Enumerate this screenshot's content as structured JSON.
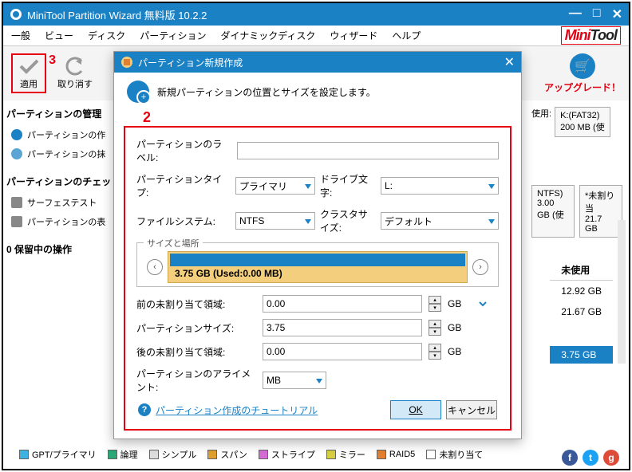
{
  "titlebar": {
    "title": "MiniTool Partition Wizard 無料版 10.2.2"
  },
  "menu": [
    "一般",
    "ビュー",
    "ディスク",
    "パーティション",
    "ダイナミックディスク",
    "ウィザード",
    "ヘルプ"
  ],
  "toolbar": {
    "apply": "適用",
    "undo": "取り消す",
    "upgrade": "アップグレード！"
  },
  "sidebar": {
    "sec1": {
      "head": "パーティションの管理",
      "items": [
        "パーティションの作",
        "パーティションの抹"
      ]
    },
    "sec2": {
      "head": "パーティションのチェッ",
      "items": [
        "サーフェステスト",
        "パーティションの表"
      ]
    },
    "sec3": {
      "head": "0 保留中の操作"
    }
  },
  "right_panel": {
    "use_label": "使用:",
    "disk_k": {
      "name": "K:(FAT32)",
      "size": "200 MB (使"
    },
    "disk_ntfs": {
      "name": "NTFS)",
      "size": "3.00 GB (使"
    },
    "disk_unalloc": {
      "name": "*未割り当",
      "size": "21.7 GB"
    },
    "col_free": "未使用",
    "val1": "12.92 GB",
    "val2": "21.67 GB",
    "val_sel": "3.75 GB"
  },
  "legend": {
    "gpt": "GPT/プライマリ",
    "logical": "論理",
    "simple": "シンプル",
    "span": "スパン",
    "stripe": "ストライプ",
    "mirror": "ミラー",
    "raid5": "RAID5",
    "unalloc": "未割り当て"
  },
  "dialog": {
    "title": "パーティション新規作成",
    "head_text": "新規パーティションの位置とサイズを設定します。",
    "labels": {
      "part_label": "パーティションのラベル:",
      "part_type": "パーティションタイプ:",
      "drive_letter": "ドライブ文字:",
      "filesystem": "ファイルシステム:",
      "cluster": "クラスタサイズ:",
      "size_loc": "サイズと場所",
      "before": "前の未割り当て領域:",
      "part_size": "パーティションサイズ:",
      "after": "後の未割り当て領域:",
      "alignment": "パーティションのアライメント:"
    },
    "values": {
      "part_label": "",
      "part_type": "プライマリ",
      "drive_letter": "L:",
      "filesystem": "NTFS",
      "cluster": "デフォルト",
      "slider_text": "3.75 GB (Used:0.00 MB)",
      "before": "0.00",
      "part_size": "3.75",
      "after": "0.00",
      "alignment": "MB",
      "unit": "GB"
    },
    "tutorial": "パーティション作成のチュートリアル",
    "ok": "OK",
    "cancel": "キャンセル"
  }
}
